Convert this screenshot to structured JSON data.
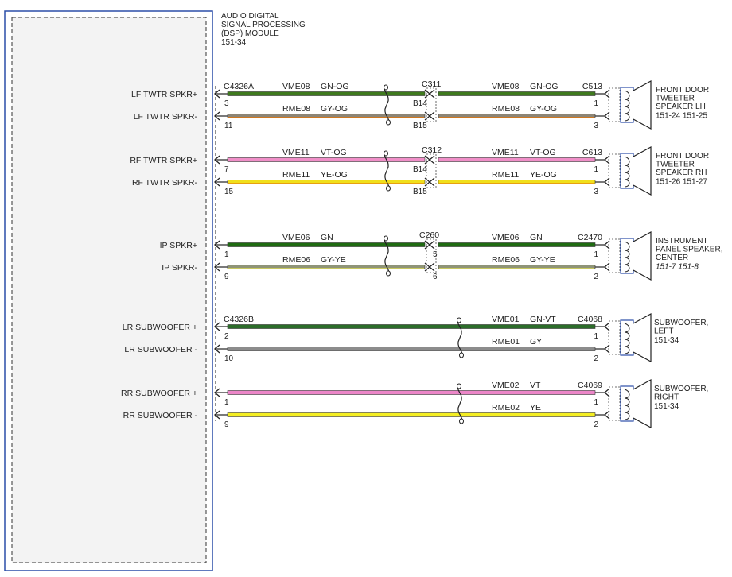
{
  "module": {
    "title_lines": [
      "AUDIO DIGITAL",
      "SIGNAL PROCESSING",
      "(DSP) MODULE",
      "151-34"
    ]
  },
  "colors": {
    "GN-OG": "#3f7a1e",
    "GN": "#1f6b12",
    "GN-VT": "#2c6d2a",
    "GY": "#8c8c8c",
    "GY-OG": "#8d8576",
    "GY-YE": "#8f9478",
    "VT-OG": "#f08fc8",
    "VT": "#ec86c8",
    "YE-OG": "#f0df1c",
    "YE": "#f4ee22",
    "frame": "#2b4ea8"
  },
  "groups": [
    {
      "pins": [
        {
          "label": "LF TWTR SPKR+",
          "left_pin": "3",
          "circuit": "VME08",
          "color_code": "GN-OG",
          "right_circuit": "VME08",
          "right_color_code": "GN-OG",
          "mid_pin": "B14",
          "end_pin": "1",
          "tint": "#8a6a20"
        },
        {
          "label": "LF TWTR SPKR-",
          "left_pin": "11",
          "circuit": "RME08",
          "color_code": "GY-OG",
          "right_circuit": "RME08",
          "right_color_code": "GY-OG",
          "mid_pin": "B15",
          "end_pin": "3",
          "tint": "#d07820"
        }
      ],
      "left_connector": "C4326A",
      "mid_connector": "C311",
      "end_connector": "C513",
      "speaker": {
        "lines": [
          "FRONT DOOR",
          "TWEETER",
          "SPEAKER LH"
        ],
        "refs": "151-24  151-25",
        "refs_italic": false
      }
    },
    {
      "pins": [
        {
          "label": "RF TWTR SPKR+",
          "left_pin": "7",
          "circuit": "VME11",
          "color_code": "VT-OG",
          "right_circuit": "VME11",
          "right_color_code": "VT-OG",
          "mid_pin": "B14",
          "end_pin": "1",
          "tint": "#f6b0da"
        },
        {
          "label": "RF TWTR SPKR-",
          "left_pin": "15",
          "circuit": "RME11",
          "color_code": "YE-OG",
          "right_circuit": "RME11",
          "right_color_code": "YE-OG",
          "mid_pin": "B15",
          "end_pin": "3",
          "tint": "#e8a010"
        }
      ],
      "left_connector": "",
      "mid_connector": "C312",
      "end_connector": "C613",
      "speaker": {
        "lines": [
          "FRONT DOOR",
          "TWEETER",
          "SPEAKER RH"
        ],
        "refs": "151-26  151-27",
        "refs_italic": false
      }
    },
    {
      "pins": [
        {
          "label": "IP SPKR+",
          "left_pin": "1",
          "circuit": "VME06",
          "color_code": "GN",
          "right_circuit": "VME06",
          "right_color_code": "GN",
          "mid_pin": "5",
          "end_pin": "1",
          "tint": "#1f6b12"
        },
        {
          "label": "IP SPKR-",
          "left_pin": "9",
          "circuit": "RME06",
          "color_code": "GY-YE",
          "right_circuit": "RME06",
          "right_color_code": "GY-YE",
          "mid_pin": "6",
          "end_pin": "2",
          "tint": "#c8c860"
        }
      ],
      "left_connector": "",
      "mid_connector": "C260",
      "end_connector": "C2470",
      "speaker": {
        "lines": [
          "INSTRUMENT",
          "PANEL SPEAKER,",
          "CENTER"
        ],
        "refs": "151-7  151-8",
        "refs_italic": true
      }
    },
    {
      "pins": [
        {
          "label": "LR SUBWOOFER +",
          "left_pin": "2",
          "circuit": "",
          "color_code": "GN-VT",
          "right_circuit": "VME01",
          "right_color_code": "GN-VT",
          "mid_pin": "",
          "end_pin": "1",
          "tint": "#2c6d2a"
        },
        {
          "label": "LR SUBWOOFER -",
          "left_pin": "10",
          "circuit": "",
          "color_code": "GY",
          "right_circuit": "RME01",
          "right_color_code": "GY",
          "mid_pin": "",
          "end_pin": "2",
          "tint": "#8c8c8c"
        }
      ],
      "left_connector": "C4326B",
      "mid_connector": "",
      "end_connector": "C4068",
      "speaker": {
        "lines": [
          "SUBWOOFER,",
          "LEFT"
        ],
        "refs": "151-34",
        "refs_italic": false
      }
    },
    {
      "pins": [
        {
          "label": "RR SUBWOOFER +",
          "left_pin": "1",
          "circuit": "",
          "color_code": "VT",
          "right_circuit": "VME02",
          "right_color_code": "VT",
          "mid_pin": "",
          "end_pin": "1",
          "tint": "#ec86c8"
        },
        {
          "label": "RR SUBWOOFER -",
          "left_pin": "9",
          "circuit": "",
          "color_code": "YE",
          "right_circuit": "RME02",
          "right_color_code": "YE",
          "mid_pin": "",
          "end_pin": "2",
          "tint": "#f4ee22"
        }
      ],
      "left_connector": "",
      "mid_connector": "",
      "end_connector": "C4069",
      "speaker": {
        "lines": [
          "SUBWOOFER,",
          "RIGHT"
        ],
        "refs": "151-34",
        "refs_italic": false
      }
    }
  ]
}
